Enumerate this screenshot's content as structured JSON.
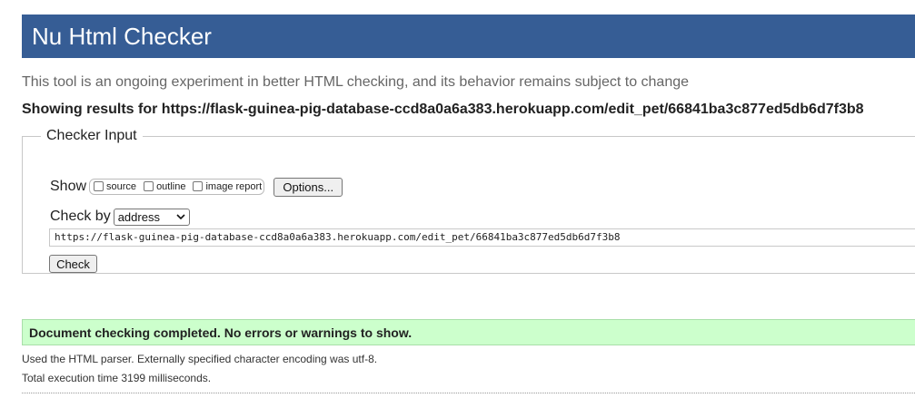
{
  "header": {
    "title": "Nu Html Checker"
  },
  "intro": "This tool is an ongoing experiment in better HTML checking, and its behavior remains subject to change",
  "results_for": "Showing results for https://flask-guinea-pig-database-ccd8a0a6a383.herokuapp.com/edit_pet/66841ba3c877ed5db6d7f3b8",
  "checker": {
    "legend": "Checker Input",
    "show_label": "Show",
    "show_options": [
      {
        "label": "source",
        "checked": false
      },
      {
        "label": "outline",
        "checked": false
      },
      {
        "label": "image report",
        "checked": false
      }
    ],
    "options_button": "Options...",
    "check_by_label": "Check by",
    "check_by_value": "address",
    "url_value": "https://flask-guinea-pig-database-ccd8a0a6a383.herokuapp.com/edit_pet/66841ba3c877ed5db6d7f3b8",
    "check_button": "Check"
  },
  "result": {
    "message": "Document checking completed. No errors or warnings to show.",
    "parser_info": "Used the HTML parser. Externally specified character encoding was utf-8.",
    "execution_time": "Total execution time 3199 milliseconds."
  },
  "colors": {
    "header_bg": "#365d95",
    "success_bg": "#ccffcc"
  }
}
